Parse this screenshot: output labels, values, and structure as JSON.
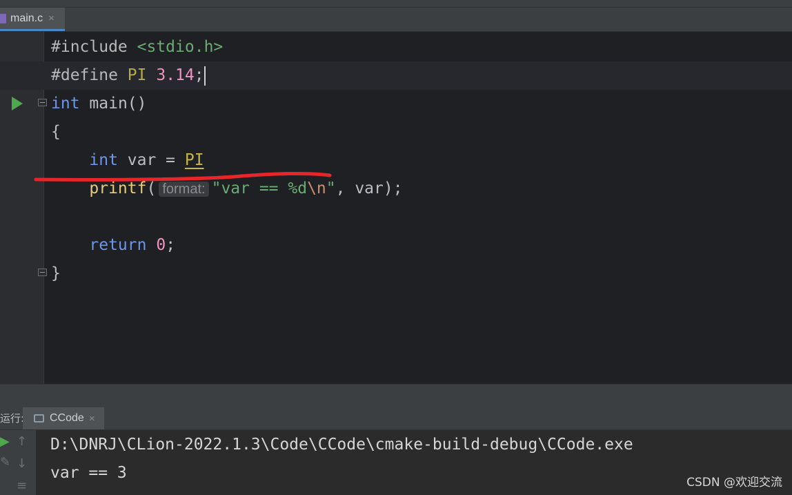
{
  "editor_tab": {
    "label": "main.c",
    "close": "×"
  },
  "code_lines": [
    {
      "directive": "#include",
      "header": "<stdio.h>"
    },
    {
      "directive": "#define",
      "macro": "PI",
      "value": "3.14",
      "semi": ";"
    },
    {
      "type": "int",
      "name": "main()"
    },
    {
      "brace": "{"
    },
    {
      "type": "int",
      "rest": " var = ",
      "macro": "PI"
    },
    {
      "fn": "printf",
      "open": "(",
      "hint": "format:",
      "str": "\"var == %d",
      "esc": "\\n",
      "strend": "\"",
      "rest": ", var);"
    },
    {
      "blank": ""
    },
    {
      "kw": "return",
      "num": "0",
      "semi": ";"
    },
    {
      "brace": "}"
    }
  ],
  "run_panel": {
    "label": "运行:",
    "tab_label": "CCode",
    "tab_close": "×"
  },
  "console": {
    "lines": [
      "D:\\DNRJ\\CLion-2022.1.3\\Code\\CCode\\cmake-build-debug\\CCode.exe",
      "var == 3"
    ]
  },
  "watermark": "CSDN @欢迎交流",
  "colors": {
    "keyword": "#6c95eb",
    "string": "#6aab73",
    "number": "#ed94c0",
    "macro": "#b5a94a",
    "annotation_underline": "#e8262a"
  }
}
